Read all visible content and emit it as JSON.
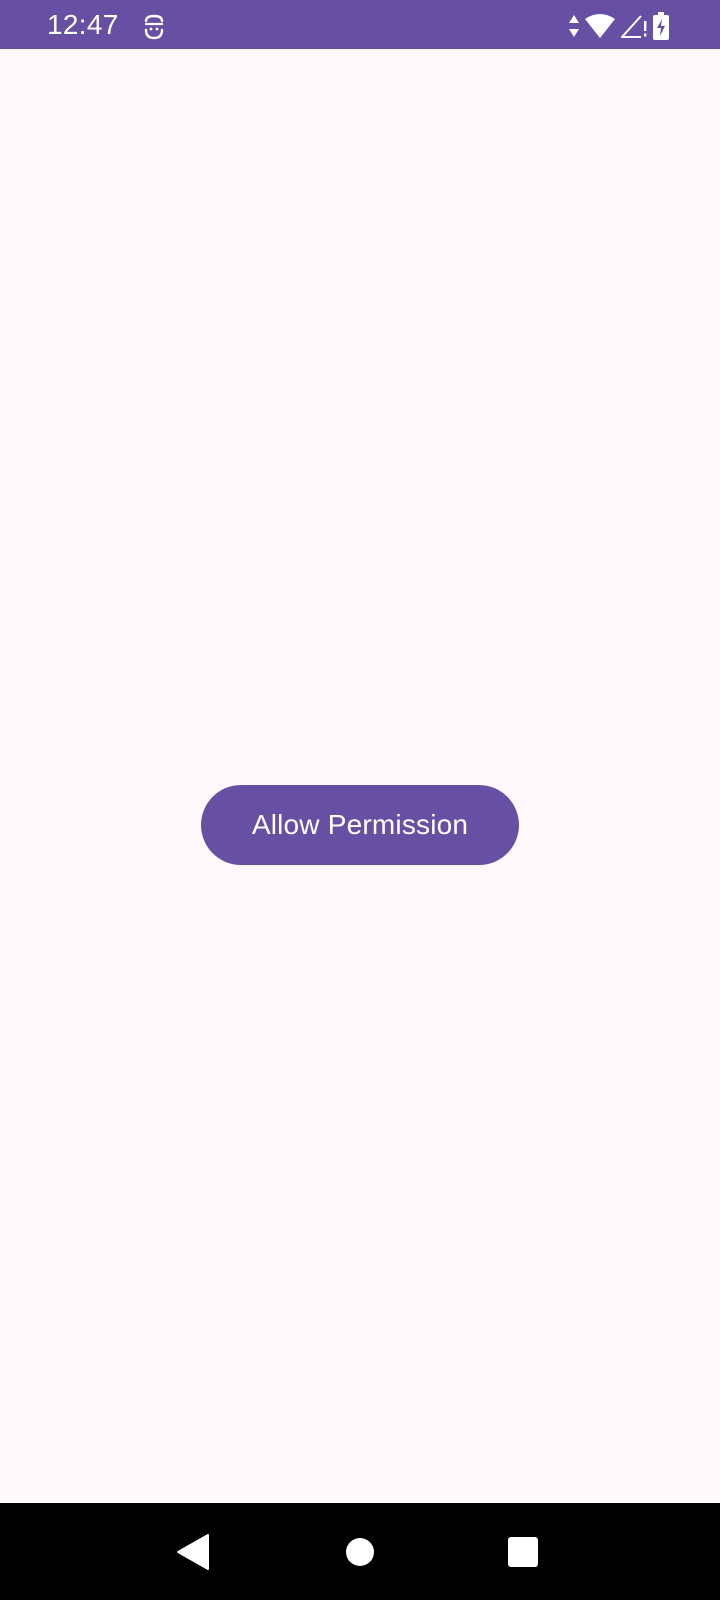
{
  "status_bar": {
    "time": "12:47",
    "bg_color": "#6750A4",
    "notification_icon": "face-scan-icon",
    "icons": [
      "data-arrows-icon",
      "wifi-icon",
      "signal-no-service-icon",
      "battery-charging-icon"
    ]
  },
  "main": {
    "allow_button_label": "Allow Permission",
    "bg_color": "#FFF9FC",
    "button_color": "#6750A4"
  },
  "nav_bar": {
    "bg_color": "#000000",
    "buttons": [
      "back-icon",
      "home-icon",
      "recents-icon"
    ]
  }
}
